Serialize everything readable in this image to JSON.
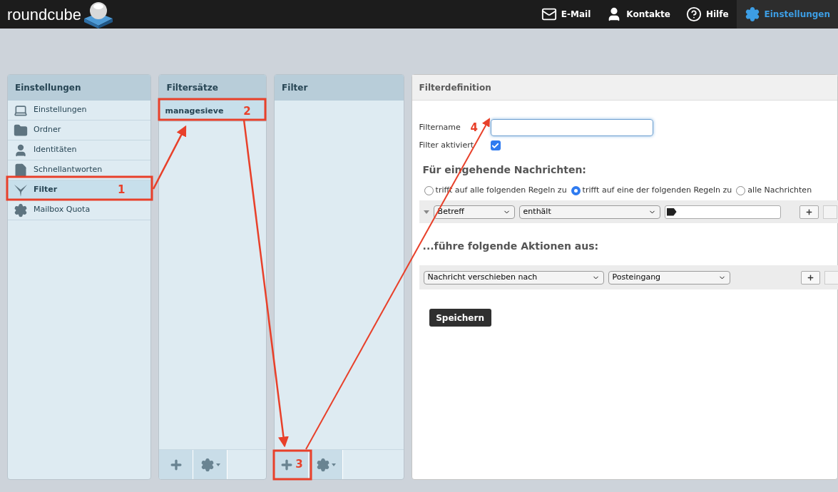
{
  "header": {
    "logo": "roundcube",
    "nav": [
      {
        "label": "E-Mail",
        "kind": "mail",
        "selected": false
      },
      {
        "label": "Kontakte",
        "kind": "user",
        "selected": false
      },
      {
        "label": "Hilfe",
        "kind": "help",
        "selected": false
      },
      {
        "label": "Einstellungen",
        "kind": "gear",
        "selected": true
      }
    ]
  },
  "settings_panel": {
    "title": "Einstellungen",
    "items": [
      {
        "label": "Einstellungen",
        "kind": "laptop",
        "selected": false
      },
      {
        "label": "Ordner",
        "kind": "folder",
        "selected": false
      },
      {
        "label": "Identitäten",
        "kind": "user",
        "selected": false
      },
      {
        "label": "Schnellantworten",
        "kind": "file",
        "selected": false
      },
      {
        "label": "Filter",
        "kind": "filter",
        "selected": true,
        "callout": "1"
      },
      {
        "label": "Mailbox Quota",
        "kind": "gear",
        "selected": false
      }
    ]
  },
  "filtersets_panel": {
    "title": "Filtersätze",
    "items": [
      {
        "label": "managesieve",
        "selected": true,
        "callout": "2"
      }
    ]
  },
  "filters_panel": {
    "title": "Filter",
    "callout": "3"
  },
  "form": {
    "title": "Filterdefinition",
    "name_label": "Filtername",
    "callout": "4",
    "enabled_label": "Filter aktiviert",
    "enabled": true,
    "rules_heading": "Für eingehende Nachrichten:",
    "match_options": [
      {
        "label": "trifft auf alle folgenden Regeln zu",
        "selected": false
      },
      {
        "label": "trifft auf eine der folgenden Regeln zu",
        "selected": true
      },
      {
        "label": "alle Nachrichten",
        "selected": false
      }
    ],
    "rule": {
      "header": "Betreff",
      "operator": "enthält"
    },
    "actions_heading": "...führe folgende Aktionen aus:",
    "action": {
      "type": "Nachricht verschieben nach",
      "target": "Posteingang"
    },
    "save": "Speichern"
  }
}
